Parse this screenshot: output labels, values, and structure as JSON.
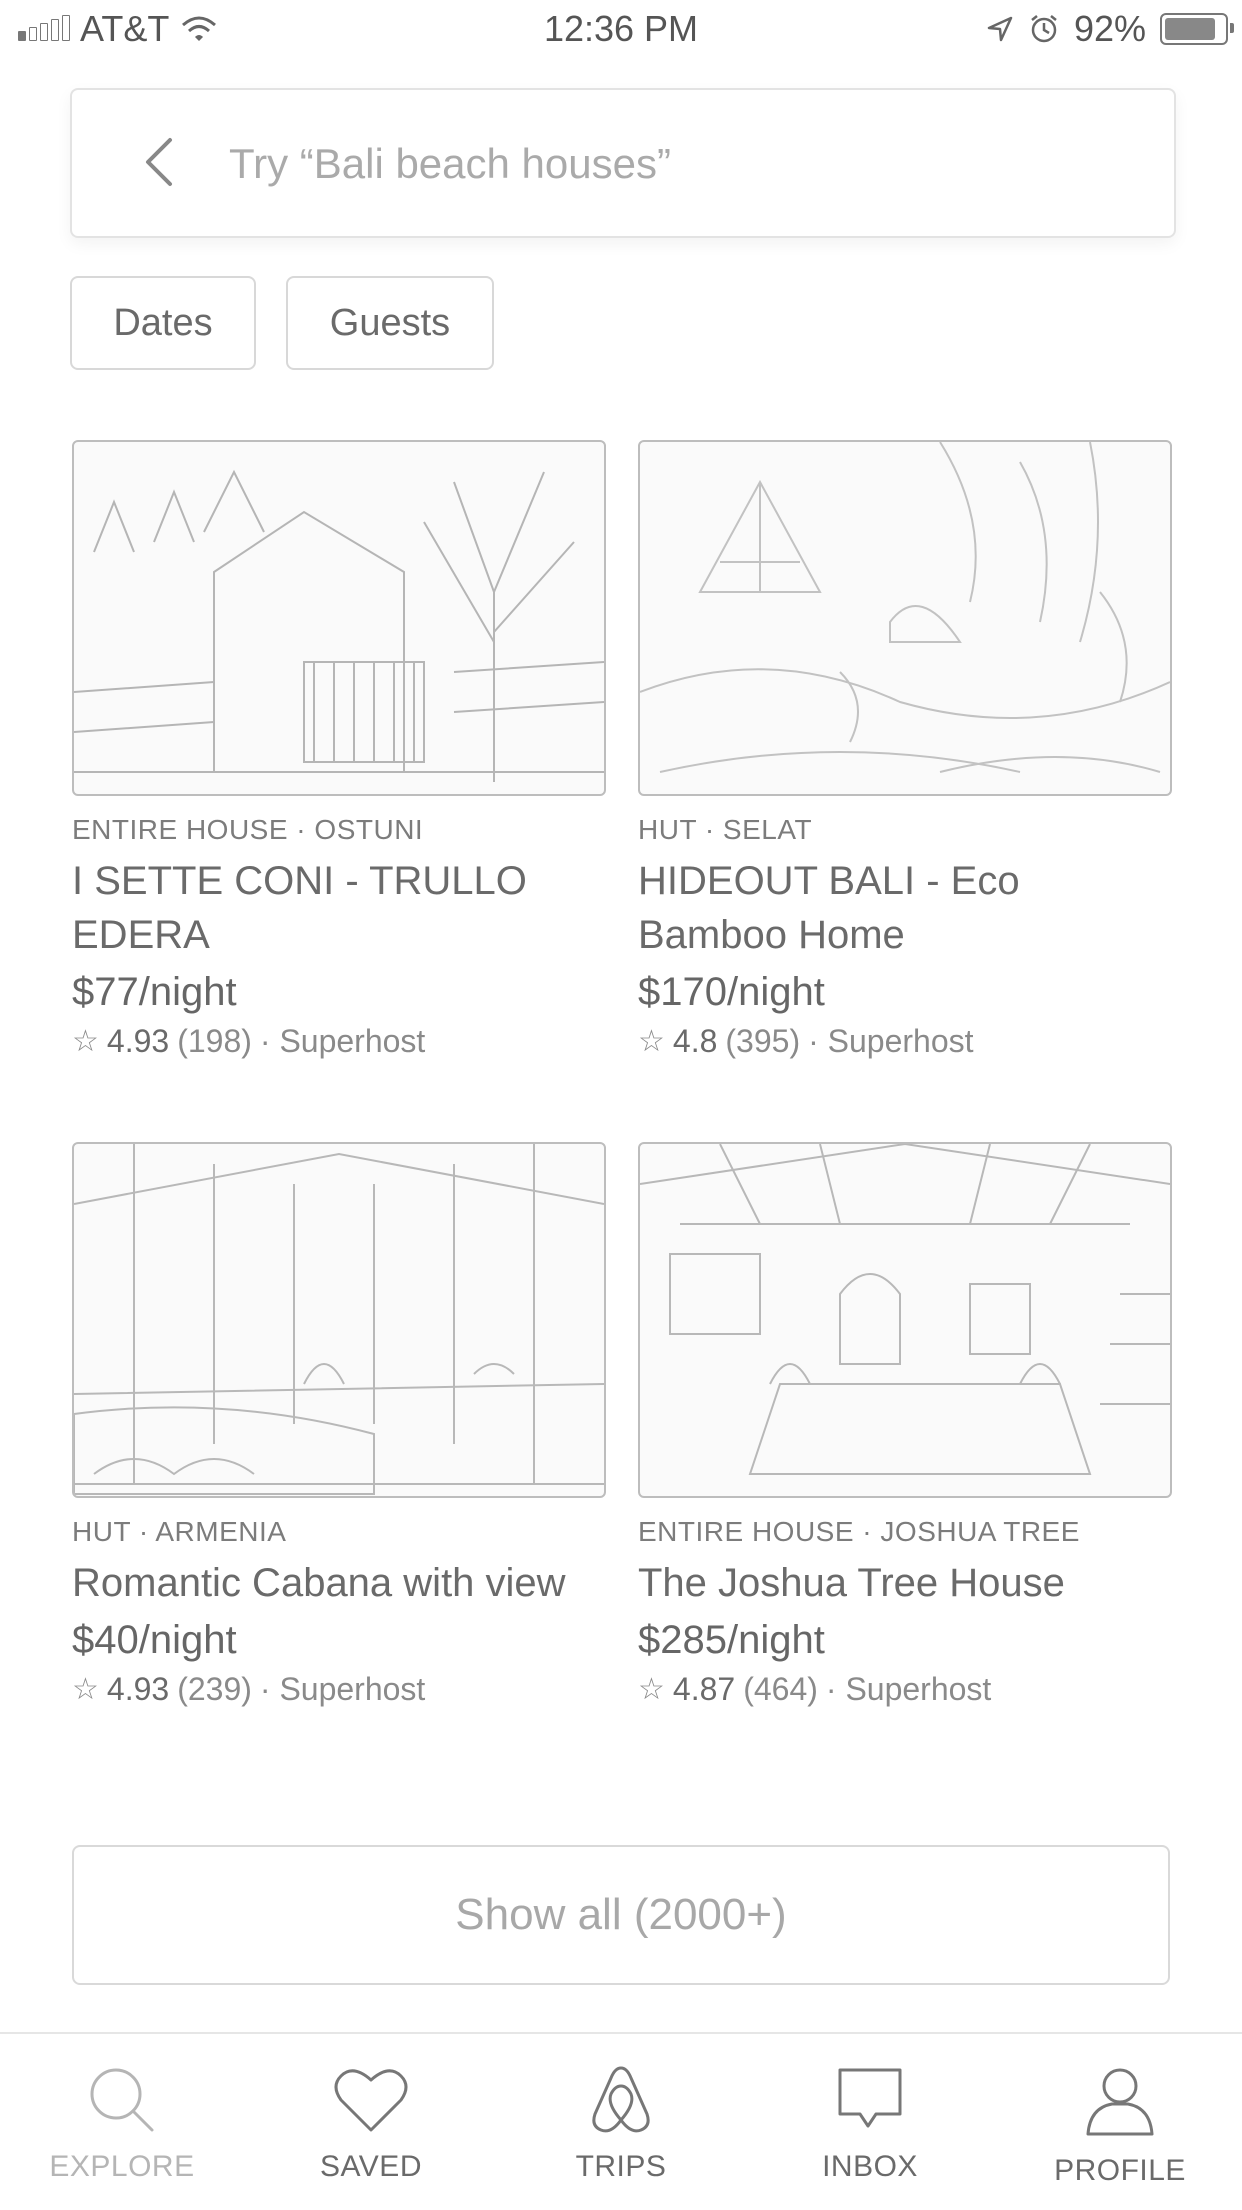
{
  "status_bar": {
    "carrier": "AT&T",
    "time": "12:36 PM",
    "battery_percent": "92%",
    "battery_level": 0.92
  },
  "search": {
    "placeholder": "Try “Bali beach houses”"
  },
  "filters": {
    "dates_label": "Dates",
    "guests_label": "Guests"
  },
  "listings": [
    {
      "kind": "ENTIRE HOUSE · OSTUNI",
      "title": "I SETTE CONI - TRULLO EDERA",
      "price": "$77/night",
      "score": "4.93",
      "reviews": "(198)",
      "badge": "· Superhost"
    },
    {
      "kind": "HUT · SELAT",
      "title": "HIDEOUT BALI - Eco Bamboo Home",
      "price": "$170/night",
      "score": "4.8",
      "reviews": "(395)",
      "badge": "· Superhost"
    },
    {
      "kind": "HUT · ARMENIA",
      "title": "Romantic Cabana with view",
      "price": "$40/night",
      "score": "4.93",
      "reviews": "(239)",
      "badge": "· Superhost"
    },
    {
      "kind": "ENTIRE HOUSE · JOSHUA TREE",
      "title": "The Joshua Tree House",
      "price": "$285/night",
      "score": "4.87",
      "reviews": "(464)",
      "badge": "· Superhost"
    }
  ],
  "show_all_label": "Show all (2000+)",
  "tabs": [
    {
      "label": "EXPLORE",
      "icon": "search-icon",
      "active": true
    },
    {
      "label": "SAVED",
      "icon": "heart-icon",
      "active": false
    },
    {
      "label": "TRIPS",
      "icon": "airbnb-logo-icon",
      "active": false
    },
    {
      "label": "INBOX",
      "icon": "chat-bubble-icon",
      "active": false
    },
    {
      "label": "PROFILE",
      "icon": "person-icon",
      "active": false
    }
  ]
}
